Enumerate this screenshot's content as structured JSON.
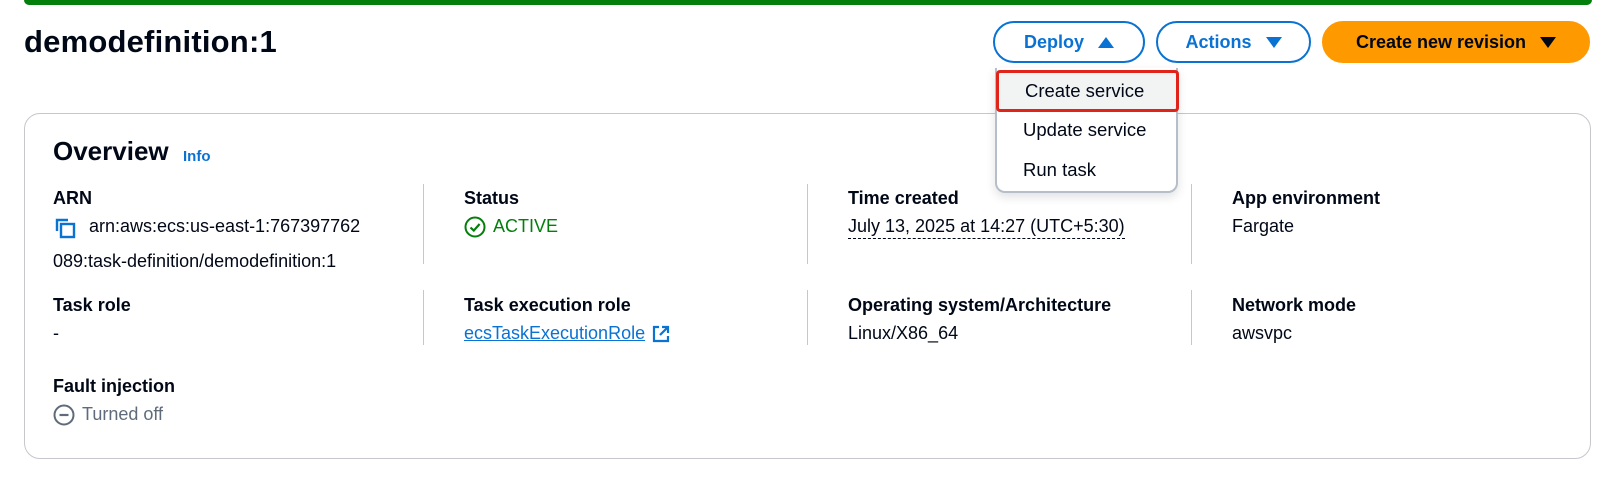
{
  "header": {
    "title": "demodefinition:1",
    "deploy_label": "Deploy",
    "actions_label": "Actions",
    "create_revision_label": "Create new revision"
  },
  "deploy_menu": {
    "items": [
      "Create service",
      "Update service",
      "Run task"
    ],
    "highlighted": "Create service"
  },
  "overview": {
    "title": "Overview",
    "info_label": "Info",
    "arn": {
      "label": "ARN",
      "line1": "arn:aws:ecs:us-east-1:767397762",
      "line2": "089:task-definition/demodefinition:1",
      "icon": "copy-icon"
    },
    "status": {
      "label": "Status",
      "value": "ACTIVE",
      "icon": "check-circle-icon"
    },
    "time_created": {
      "label": "Time created",
      "value": "July 13, 2025 at 14:27 (UTC+5:30)"
    },
    "app_environment": {
      "label": "App environment",
      "value": "Fargate"
    },
    "task_role": {
      "label": "Task role",
      "value": "-"
    },
    "task_execution_role": {
      "label": "Task execution role",
      "value": "ecsTaskExecutionRole",
      "icon": "external-link-icon"
    },
    "os_arch": {
      "label": "Operating system/Architecture",
      "value": "Linux/X86_64"
    },
    "network_mode": {
      "label": "Network mode",
      "value": "awsvpc"
    },
    "fault_injection": {
      "label": "Fault injection",
      "value": "Turned off",
      "icon": "minus-circle-icon"
    }
  },
  "colors": {
    "accent_blue": "#0972d3",
    "primary_orange": "#ff9900",
    "status_green": "#037f0c",
    "highlight_red": "#e0241a",
    "muted_gray": "#5f6b7a"
  }
}
